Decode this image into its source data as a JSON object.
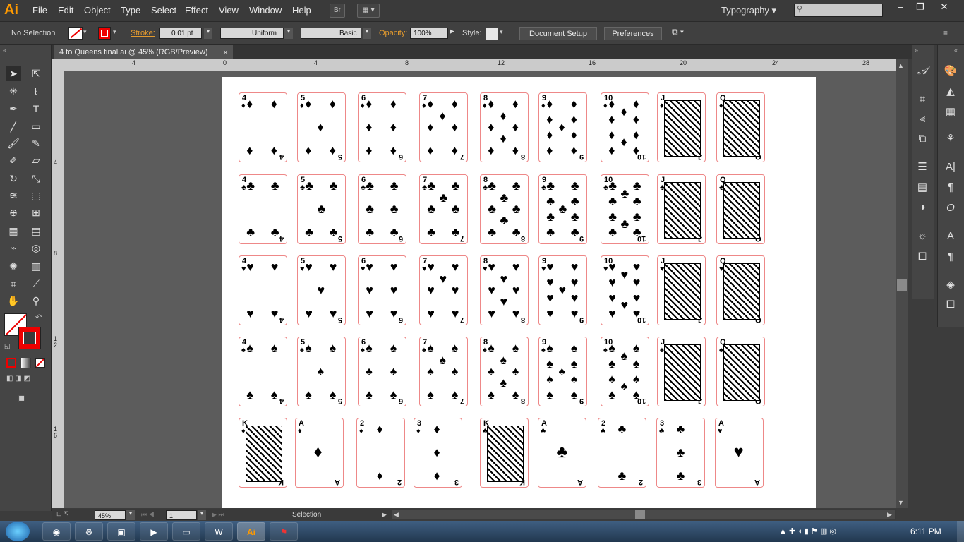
{
  "app": {
    "logo": "Ai"
  },
  "menu": [
    "File",
    "Edit",
    "Object",
    "Type",
    "Select",
    "Effect",
    "View",
    "Window",
    "Help"
  ],
  "bridge_label": "Br",
  "workspace": "Typography",
  "control": {
    "selection": "No Selection",
    "stroke_label": "Stroke:",
    "stroke_value": "0.01 pt",
    "profile": "Uniform",
    "brush": "Basic",
    "opacity_label": "Opacity:",
    "opacity_value": "100%",
    "style_label": "Style:",
    "doc_setup": "Document Setup",
    "preferences": "Preferences"
  },
  "document_tab": {
    "title": "4 to Queens final.ai @ 45% (RGB/Preview)",
    "close": "×"
  },
  "ruler": {
    "h_labels": [
      "4",
      "0",
      "4",
      "8",
      "12",
      "16",
      "20",
      "24",
      "28"
    ],
    "v_labels": [
      "4",
      "8",
      "1 2",
      "1 6"
    ]
  },
  "status": {
    "zoom": "45%",
    "page": "1",
    "tool": "Selection"
  },
  "clock": "6:11 PM",
  "cards": {
    "rows": [
      {
        "suit": "♦",
        "ranks": [
          "4",
          "5",
          "6",
          "7",
          "8",
          "9",
          "10",
          "J",
          "Q"
        ]
      },
      {
        "suit": "♣",
        "ranks": [
          "4",
          "5",
          "6",
          "7",
          "8",
          "9",
          "10",
          "J",
          "Q"
        ]
      },
      {
        "suit": "♥",
        "ranks": [
          "4",
          "5",
          "6",
          "7",
          "8",
          "9",
          "10",
          "J",
          "Q"
        ]
      },
      {
        "suit": "♠",
        "ranks": [
          "4",
          "5",
          "6",
          "7",
          "8",
          "9",
          "10",
          "J",
          "Q"
        ]
      }
    ],
    "bottom_row": [
      {
        "rank": "K",
        "suit": "♦"
      },
      {
        "rank": "A",
        "suit": "♦"
      },
      {
        "rank": "2",
        "suit": "♦"
      },
      {
        "rank": "3",
        "suit": "♦"
      },
      {
        "rank": "K",
        "suit": "♣"
      },
      {
        "rank": "A",
        "suit": "♣"
      },
      {
        "rank": "2",
        "suit": "♣"
      },
      {
        "rank": "3",
        "suit": "♣"
      },
      {
        "rank": "A",
        "suit": "♥"
      }
    ]
  },
  "colors": {
    "accent_orange": "#ff9a00",
    "stroke_red": "#e00000",
    "card_border": "#ee8888"
  }
}
